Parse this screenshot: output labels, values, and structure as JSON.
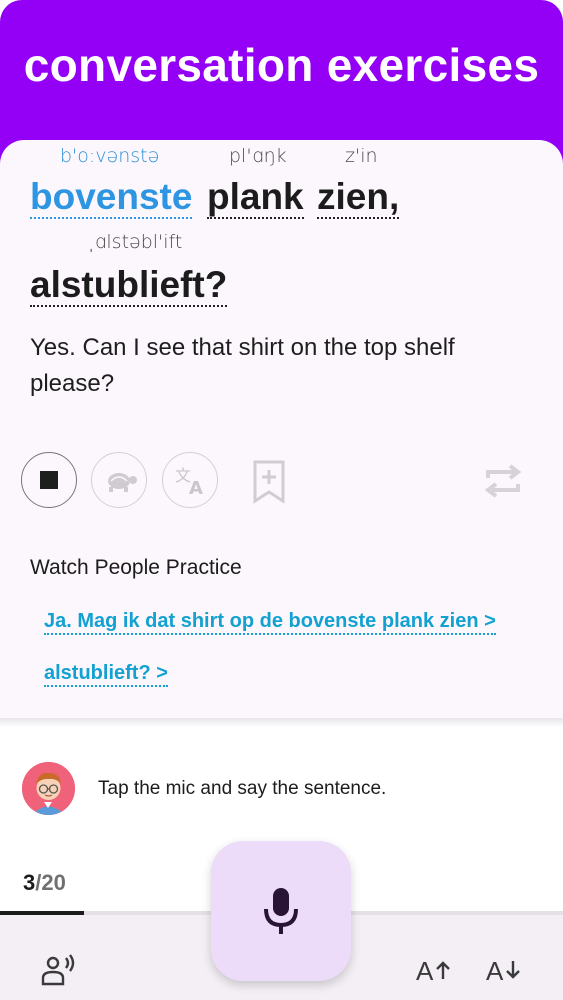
{
  "header": {
    "title": "conversation exercises"
  },
  "sentence": {
    "words": [
      {
        "text": "bovenste",
        "ipa": "b'o:vənstə",
        "highlight": true
      },
      {
        "text": "plank",
        "ipa": "pl'ɑŋk",
        "highlight": false
      },
      {
        "text": "zien,",
        "ipa": "z'in",
        "highlight": false
      },
      {
        "text": "alstublieft?",
        "ipa": "ˌɑlstəbl'ift",
        "highlight": false
      }
    ],
    "translation": "Yes. Can I see that shirt on the top shelf please?"
  },
  "controls": [
    {
      "name": "stop-icon"
    },
    {
      "name": "turtle-icon"
    },
    {
      "name": "translate-icon"
    },
    {
      "name": "bookmark-add-icon"
    },
    {
      "name": "repeat-icon"
    }
  ],
  "watch": {
    "title": "Watch People Practice",
    "links": [
      "Ja. Mag ik dat shirt op de bovenste plank zien >",
      "alstublieft? >"
    ]
  },
  "prompt": {
    "text": "Tap the mic and say the sentence."
  },
  "progress": {
    "current": "3",
    "total": "/20",
    "fraction": 0.15
  },
  "bottom_bar": {
    "left_icon": "voice-person-icon",
    "center_icon": "mic-icon",
    "right_icons": [
      "font-increase-icon",
      "font-decrease-icon"
    ]
  },
  "colors": {
    "header": "#9400f6",
    "highlight": "#2d95e1",
    "link": "#13a1d1",
    "mic_bg": "#ecdcfa"
  }
}
